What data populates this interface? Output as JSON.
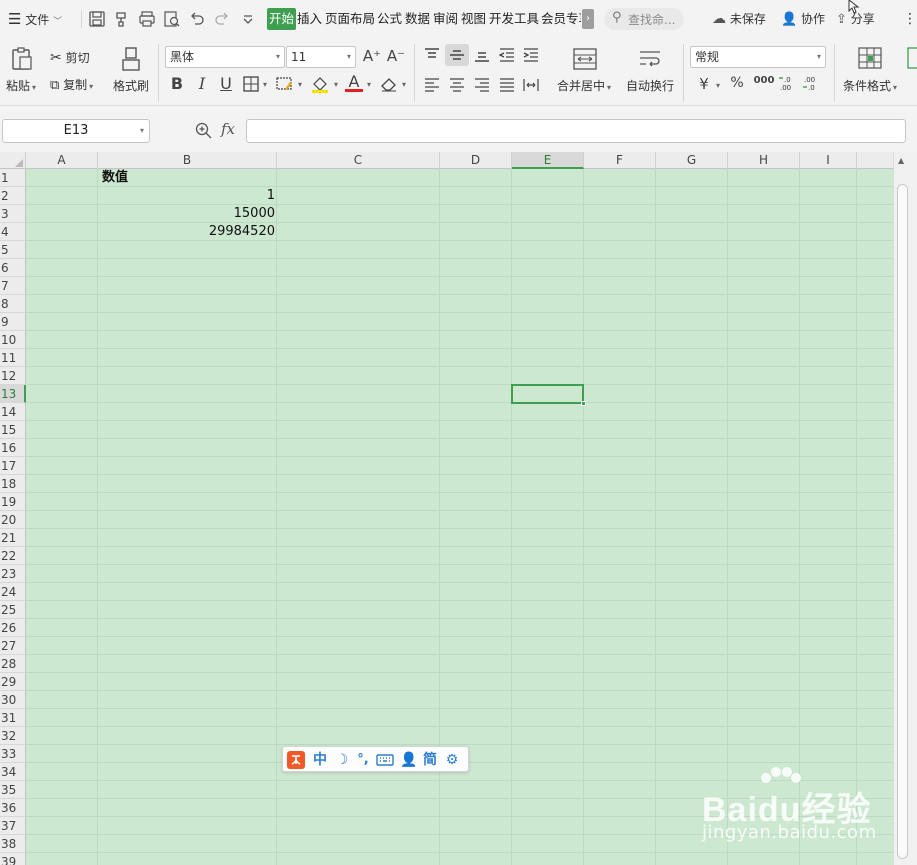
{
  "menubar": {
    "file_menu": "文件",
    "tabs": [
      "开始",
      "插入",
      "页面布局",
      "公式",
      "数据",
      "审阅",
      "视图",
      "开发工具",
      "会员专享"
    ],
    "active_tab": "开始",
    "search_placeholder": "查找命...",
    "unsaved": "未保存",
    "collaborate": "协作",
    "share": "分享"
  },
  "ribbon": {
    "paste": "粘贴",
    "cut": "剪切",
    "copy": "复制",
    "format_painter": "格式刷",
    "font_name": "黑体",
    "font_size": "11",
    "merge_center": "合并居中",
    "auto_wrap": "自动换行",
    "number_format": "常规",
    "conditional_format": "条件格式",
    "bold": "B",
    "italic": "I",
    "underline": "U",
    "font_color_glyph": "A",
    "increase_font": "A⁺",
    "decrease_font": "A⁻",
    "currency": "¥",
    "percent": "%",
    "thousands": "000"
  },
  "formula_bar": {
    "name_box": "E13",
    "fx_label": "fx",
    "formula": ""
  },
  "sheet": {
    "columns": [
      "A",
      "B",
      "C",
      "D",
      "E",
      "F",
      "G",
      "H",
      "I"
    ],
    "selected_column": "E",
    "selected_row": 13,
    "rows": [
      "1",
      "2",
      "3",
      "4",
      "5",
      "6",
      "7",
      "8",
      "9",
      "10",
      "11",
      "12",
      "13",
      "14",
      "15",
      "16",
      "17",
      "18",
      "19",
      "20",
      "21",
      "22",
      "23",
      "24",
      "25",
      "26",
      "27",
      "28",
      "29",
      "30",
      "31",
      "32",
      "33",
      "34",
      "35",
      "36",
      "37",
      "38",
      "39"
    ],
    "cells": {
      "B1": "数值",
      "B2": "1",
      "B3": "15000",
      "B4": "29984520"
    }
  },
  "ime": {
    "chinese_mode": "中",
    "simplified": "简"
  },
  "watermark": {
    "logo": "Baidu经验",
    "url": "jingyan.baidu.com"
  },
  "colors": {
    "accent_green": "#3f9f51",
    "grid_background": "#cde8d1"
  }
}
